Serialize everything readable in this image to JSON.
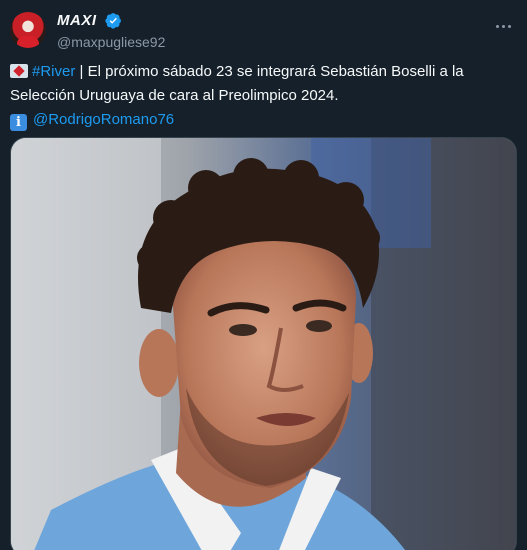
{
  "tweet": {
    "author": {
      "display_name": "MAXI",
      "handle": "@maxpugliese92",
      "verified": true,
      "avatar_icon": "avatar-image"
    },
    "more_icon": "more-dots-icon",
    "text": {
      "flag_icon": "peru-club-flag-icon",
      "hashtag": "#River",
      "line1_rest": " | El próximo sábado 23 se integrará Sebastián Boselli a la",
      "line2": "Selección Uruguaya de cara al Preolimpico 2024.",
      "info_icon": "info-icon",
      "info_glyph": "i",
      "source_mention": "@RodrigoRomano76"
    },
    "media": {
      "description_icon": "player-photo",
      "colors": {
        "skin": "#c98a6c",
        "hair": "#2a1c15",
        "jersey": "#6ea6dc",
        "collar": "#f2f2f2"
      }
    },
    "colors": {
      "background": "#15202b",
      "link": "#1d9bf0",
      "secondary_text": "#8b98a5",
      "verified": "#1d9bf0"
    }
  }
}
